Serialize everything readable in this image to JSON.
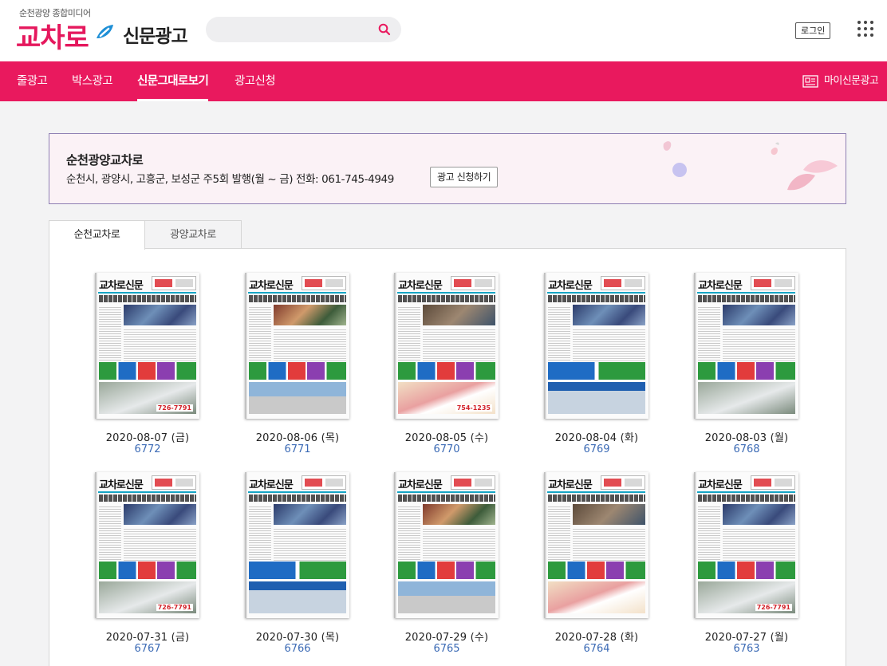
{
  "header": {
    "tagline": "순천광양 종합미디어",
    "brand": "교차로",
    "section_title": "신문광고",
    "search_placeholder": "",
    "login_label": "로그인"
  },
  "nav": {
    "items": [
      {
        "label": "줄광고",
        "active": false
      },
      {
        "label": "박스광고",
        "active": false
      },
      {
        "label": "신문그대로보기",
        "active": true
      },
      {
        "label": "광고신청",
        "active": false
      }
    ],
    "my_ad_label": "마이신문광고"
  },
  "banner": {
    "title": "순천광양교차로",
    "description": "순천시, 광양시, 고흥군, 보성군 주5회 발행(월 ~ 금) 전화: 061-745-4949",
    "apply_label": "광고 신청하기"
  },
  "tabs": [
    {
      "label": "순천교차로",
      "active": true
    },
    {
      "label": "광양교차로",
      "active": false
    }
  ],
  "papers": [
    {
      "masthead": "교차로신문",
      "date": "2020-08-07 (금)",
      "issue": "6772",
      "phone": "726-7791"
    },
    {
      "masthead": "교차로신문",
      "date": "2020-08-06 (목)",
      "issue": "6771",
      "phone": ""
    },
    {
      "masthead": "교차로신문",
      "date": "2020-08-05 (수)",
      "issue": "6770",
      "phone": "754-1235"
    },
    {
      "masthead": "교차로신문",
      "date": "2020-08-04 (화)",
      "issue": "6769",
      "phone": ""
    },
    {
      "masthead": "교차로신문",
      "date": "2020-08-03 (월)",
      "issue": "6768",
      "phone": ""
    },
    {
      "masthead": "교차로신문",
      "date": "2020-07-31 (금)",
      "issue": "6767",
      "phone": "726-7791"
    },
    {
      "masthead": "교차로신문",
      "date": "2020-07-30 (목)",
      "issue": "6766",
      "phone": ""
    },
    {
      "masthead": "교차로신문",
      "date": "2020-07-29 (수)",
      "issue": "6765",
      "phone": ""
    },
    {
      "masthead": "교차로신문",
      "date": "2020-07-28 (화)",
      "issue": "6764",
      "phone": ""
    },
    {
      "masthead": "교차로신문",
      "date": "2020-07-27 (월)",
      "issue": "6763",
      "phone": "726-7791"
    }
  ],
  "colors": {
    "brand": "#e9195e",
    "link": "#3b6ab5",
    "banner_bg": "#fbf2f6"
  }
}
